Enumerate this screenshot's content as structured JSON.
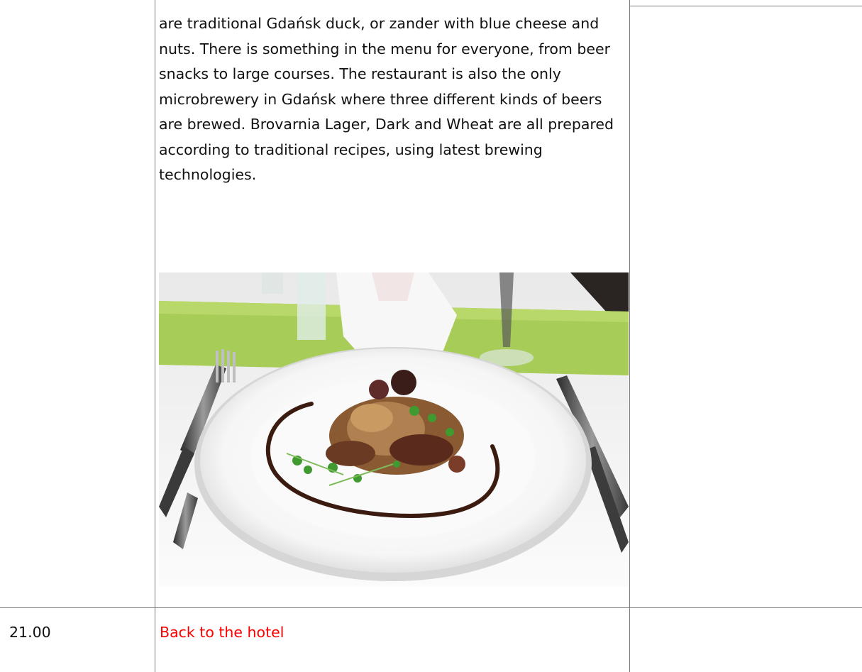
{
  "cell_text": {
    "paragraph": "are traditional Gdańsk duck, or zander with blue cheese and nuts. There is something in the menu for everyone, from beer snacks to large courses. The restaurant is also the only microbrewery in Gdańsk where three different kinds of beers are brewed. Brovarnia Lager, Dark and Wheat are all prepared according to traditional recipes, using latest brewing technologies."
  },
  "schedule": {
    "rows": [
      {
        "time": "21.00",
        "event": "Back to the hotel"
      }
    ]
  },
  "colors": {
    "border": "#7a7a7a",
    "event_text": "#ff0000",
    "text": "#111111"
  },
  "icons": {
    "photo": "plated-dish-photo"
  }
}
